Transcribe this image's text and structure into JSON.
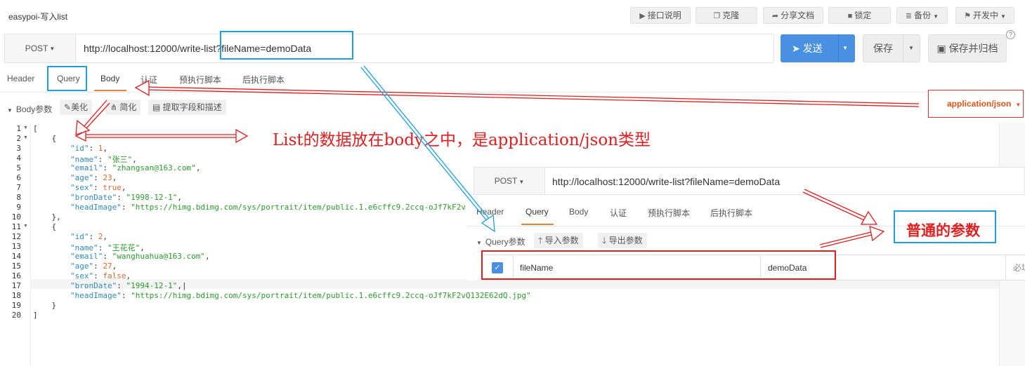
{
  "app": {
    "title": "easypoi-写入list"
  },
  "toolbar": {
    "api_doc": "接口说明",
    "api_doc_icon": "play-icon",
    "clone": "克隆",
    "clone_icon": "copy-icon",
    "share": "分享文档",
    "share_icon": "share-icon",
    "lock": "锁定",
    "lock_icon": "lock-icon",
    "backup": "备份",
    "backup_icon": "database-icon",
    "status": "开发中",
    "status_icon": "flag-icon"
  },
  "request": {
    "method": "POST",
    "url": "http://localhost:12000/write-list?fileName=demoData",
    "send": "发送",
    "save": "保存",
    "save_archive": "保存并归档",
    "accent_color": "#4a90e2"
  },
  "tabs": [
    {
      "label": "Header"
    },
    {
      "label": "Query"
    },
    {
      "label": "Body",
      "active": true
    },
    {
      "label": "认证"
    },
    {
      "label": "预执行脚本"
    },
    {
      "label": "后执行脚本"
    }
  ],
  "body_bar": {
    "label": "Body参数",
    "beautify": "美化",
    "simplify": "简化",
    "extract": "提取字段和描述",
    "content_type": "application/json"
  },
  "editor": {
    "line_numbers": [
      "1",
      "2",
      "3",
      "4",
      "5",
      "6",
      "7",
      "8",
      "9",
      "10",
      "11",
      "12",
      "13",
      "14",
      "15",
      "16",
      "17",
      "18",
      "19",
      "20"
    ],
    "records": [
      {
        "id": "1",
        "name": "\"张三\"",
        "email": "\"zhangsan@163.com\"",
        "age": "23",
        "sex": "true",
        "bronDate": "\"1998-12-1\"",
        "headImage": "\"https://himg.bdimg.com/sys/portrait/item/public.1.e6cffc9.2ccq-oJf7kF2v"
      },
      {
        "id": "2",
        "name": "\"王花花\"",
        "email": "\"wanghuahua@163.com\"",
        "age": "27",
        "sex": "false",
        "bronDate": "\"1994-12-1\"",
        "headImage": "\"https://himg.bdimg.com/sys/portrait/item/public.1.e6cffc9.2ccq-oJf7kF2vQ132E62dQ.jpg\""
      }
    ]
  },
  "overlay": {
    "method": "POST",
    "url": "http://localhost:12000/write-list?fileName=demoData",
    "tabs": [
      {
        "label": "Header"
      },
      {
        "label": "Query",
        "active": true
      },
      {
        "label": "Body"
      },
      {
        "label": "认证"
      },
      {
        "label": "预执行脚本"
      },
      {
        "label": "后执行脚本"
      }
    ],
    "query_label": "Query参数",
    "import": "导入参数",
    "export": "导出参数",
    "param": {
      "name": "fileName",
      "value": "demoData",
      "required": "必填"
    }
  },
  "annotations": {
    "body_note": "List的数据放在body之中，是application/json类型",
    "query_note": "普通的参数",
    "red": "#e02020",
    "blue": "#1ea0e0"
  }
}
